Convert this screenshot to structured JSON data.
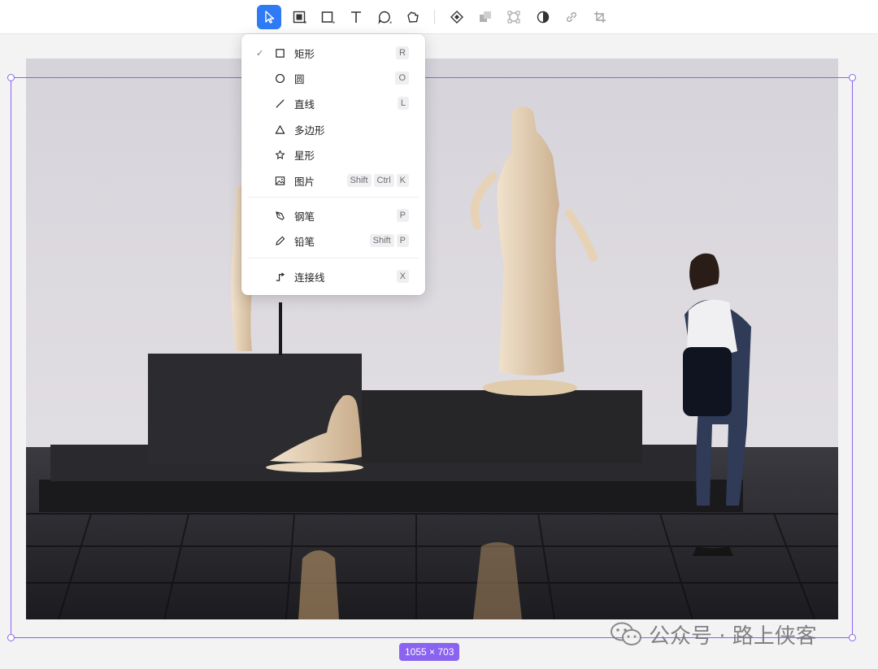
{
  "toolbar": {
    "tools": [
      {
        "name": "move-tool",
        "icon": "cursor-arrow-icon",
        "active": true
      },
      {
        "name": "frame-tool",
        "icon": "frame-icon"
      },
      {
        "name": "shape-tool",
        "icon": "rectangle-icon"
      },
      {
        "name": "text-tool",
        "icon": "text-T-icon"
      },
      {
        "name": "comment-tool",
        "icon": "speech-bubble-icon"
      },
      {
        "name": "plugin-tool",
        "icon": "puzzle-icon"
      },
      {
        "name": "component-tool",
        "icon": "component-diamond-icon"
      },
      {
        "name": "boolean-tool",
        "icon": "boolean-squares-icon"
      },
      {
        "name": "mask-tool",
        "icon": "transform-box-icon"
      },
      {
        "name": "contrast-tool",
        "icon": "half-circle-icon"
      },
      {
        "name": "link-tool",
        "icon": "link-icon"
      },
      {
        "name": "crop-tool",
        "icon": "crop-icon"
      }
    ],
    "accent_color": "#2f7bf5"
  },
  "shape_menu": {
    "items": [
      {
        "label": "矩形",
        "icon": "rectangle-icon",
        "checked": true,
        "shortcut": [
          "R"
        ]
      },
      {
        "label": "圆",
        "icon": "circle-icon",
        "shortcut": [
          "O"
        ]
      },
      {
        "label": "直线",
        "icon": "line-icon",
        "shortcut": [
          "L"
        ]
      },
      {
        "label": "多边形",
        "icon": "triangle-icon",
        "shortcut": []
      },
      {
        "label": "星形",
        "icon": "star-icon",
        "shortcut": []
      },
      {
        "label": "图片",
        "icon": "image-icon",
        "shortcut": [
          "Shift",
          "Ctrl",
          "K"
        ]
      },
      {
        "label": "钢笔",
        "icon": "pen-icon",
        "shortcut": [
          "P"
        ]
      },
      {
        "label": "铅笔",
        "icon": "pencil-icon",
        "shortcut": [
          "Shift",
          "P"
        ]
      },
      {
        "label": "连接线",
        "icon": "connector-icon",
        "shortcut": [
          "X"
        ]
      }
    ],
    "check_glyph": "✓"
  },
  "canvas": {
    "selection_size": "1055 × 703",
    "selection_color": "#8a63f0"
  },
  "watermark": {
    "text": "公众号 · 路上侠客"
  }
}
